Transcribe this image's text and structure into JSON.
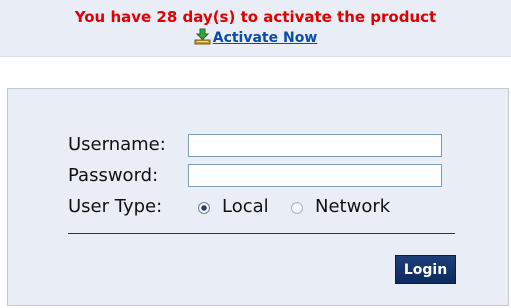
{
  "banner": {
    "message": "You have 28 day(s) to activate the product",
    "activate_link": "Activate Now",
    "icon": "download-arrow-icon"
  },
  "login_form": {
    "username_label": "Username:",
    "username_value": "",
    "password_label": "Password:",
    "password_value": "",
    "user_type_label": "User Type:",
    "user_type_options": [
      "Local",
      "Network"
    ],
    "user_type_selected": "Local",
    "login_button": "Login"
  },
  "colors": {
    "banner_text": "#e00000",
    "link": "#0b4da8",
    "panel_bg": "#e9eef6",
    "button_bg": "#153468"
  }
}
